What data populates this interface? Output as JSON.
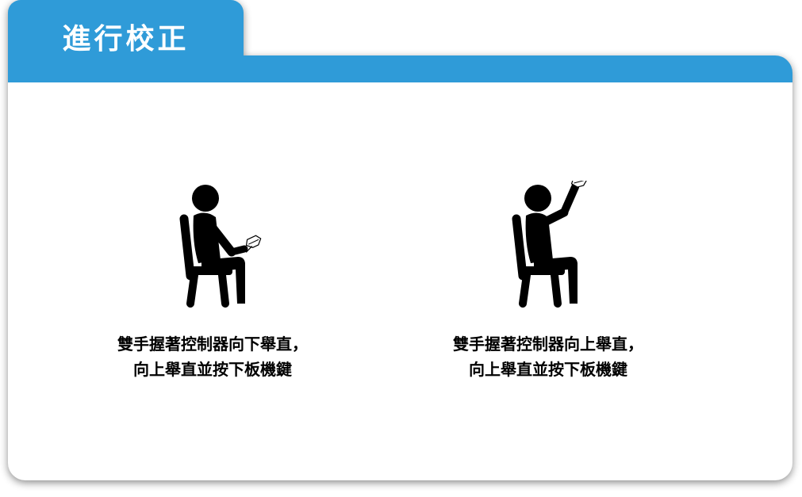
{
  "header": {
    "title": "進行校正"
  },
  "steps": [
    {
      "caption": "雙手握著控制器向下舉直，\n向上舉直並按下板機鍵",
      "icon": "seated-person-arms-down-icon"
    },
    {
      "caption": "雙手握著控制器向上舉直，\n向上舉直並按下板機鍵",
      "icon": "seated-person-arm-up-icon"
    }
  ],
  "colors": {
    "accent": "#2f9bd8",
    "panel": "#ffffff",
    "text": "#000000"
  }
}
